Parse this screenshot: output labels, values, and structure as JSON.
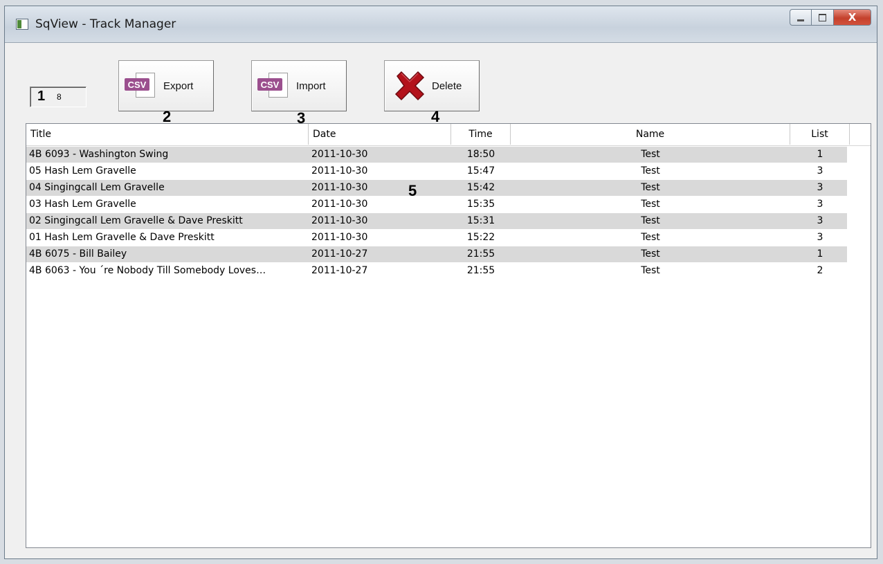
{
  "window": {
    "title": "SqView - Track Manager",
    "close_glyph": "X"
  },
  "counter": {
    "big": "1",
    "small": "8"
  },
  "toolbar": {
    "export_label": "Export",
    "import_label": "Import",
    "delete_label": "Delete",
    "csv_tag": "CSV"
  },
  "callouts": [
    "2",
    "3",
    "4",
    "5"
  ],
  "table": {
    "columns": [
      "Title",
      "Date",
      "Time",
      "Name",
      "List"
    ],
    "rows": [
      [
        "4B 6093 - Washington Swing",
        "2011-10-30",
        "18:50",
        "Test",
        "1"
      ],
      [
        "05 Hash Lem Gravelle",
        "2011-10-30",
        "15:47",
        "Test",
        "3"
      ],
      [
        "04 Singingcall Lem Gravelle",
        "2011-10-30",
        "15:42",
        "Test",
        "3"
      ],
      [
        "03 Hash Lem Gravelle",
        "2011-10-30",
        "15:35",
        "Test",
        "3"
      ],
      [
        "02 Singingcall Lem Gravelle & Dave Preskitt",
        "2011-10-30",
        "15:31",
        "Test",
        "3"
      ],
      [
        "01 Hash Lem Gravelle & Dave Preskitt",
        "2011-10-30",
        "15:22",
        "Test",
        "3"
      ],
      [
        "4B 6075 - Bill Bailey",
        "2011-10-27",
        "21:55",
        "Test",
        "1"
      ],
      [
        "4B 6063 - You ´re Nobody Till Somebody Loves…",
        "2011-10-27",
        "21:55",
        "Test",
        "2"
      ]
    ]
  },
  "colors": {
    "csv_tag": "#9b4f8e",
    "delete_x": "#b3121b",
    "row_alt": "#d9d9d9",
    "close_button": "#c4412c"
  },
  "icons": [
    "app-icon",
    "minimize-icon",
    "maximize-icon",
    "close-icon",
    "csv-file-icon",
    "delete-x-icon"
  ]
}
